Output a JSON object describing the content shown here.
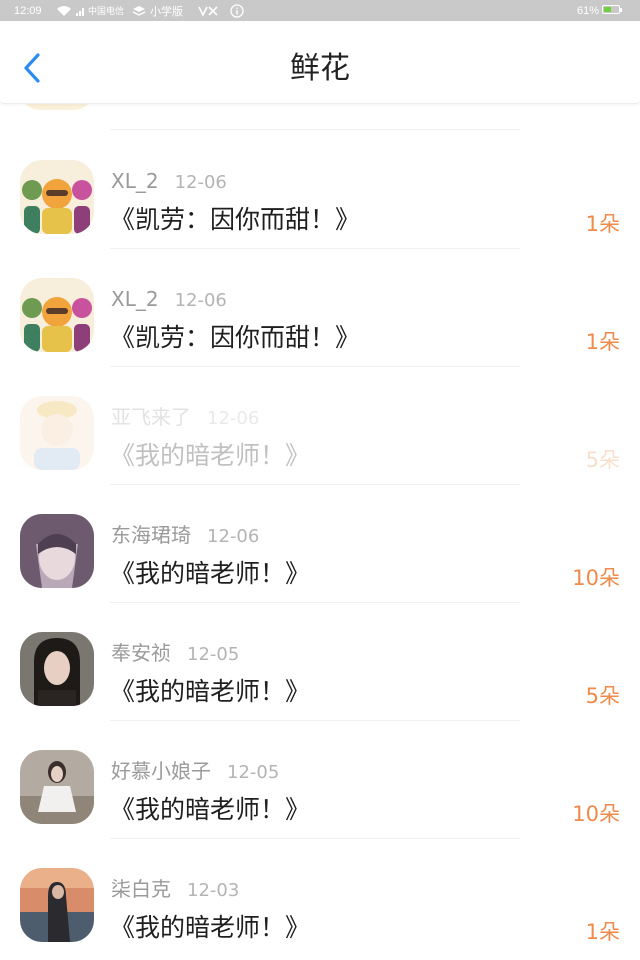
{
  "status_bar": {
    "time": "12:09",
    "carrier": "中国电信",
    "app_label": "小学版",
    "battery": "61%"
  },
  "header": {
    "title": "鲜花",
    "back_icon": "chevron-left-icon",
    "accent_color": "#2d8cf0"
  },
  "flower_list": [
    {
      "name": "XL_2",
      "date": "12-06",
      "title": "《凯劳：因你而甜！》",
      "count": "1朵",
      "avatar": "cartoon-group-avatar"
    },
    {
      "name": "XL_2",
      "date": "12-06",
      "title": "《凯劳：因你而甜！》",
      "count": "1朵",
      "avatar": "cartoon-group-avatar"
    },
    {
      "name": "亚飞来了",
      "date": "12-06",
      "title": "《我的暗老师！》",
      "count": "5朵",
      "avatar": "cartoon-man-avatar"
    },
    {
      "name": "东海珺琦",
      "date": "12-06",
      "title": "《我的暗老师！》",
      "count": "10朵",
      "avatar": "anime-girl-avatar"
    },
    {
      "name": "奉安祯",
      "date": "12-05",
      "title": "《我的暗老师！》",
      "count": "5朵",
      "avatar": "photo-girl-avatar"
    },
    {
      "name": "好慕小娘子",
      "date": "12-05",
      "title": "《我的暗老师！》",
      "count": "10朵",
      "avatar": "photo-girl-sitting-avatar"
    },
    {
      "name": "柒白克",
      "date": "12-03",
      "title": "《我的暗老师！》",
      "count": "1朵",
      "avatar": "sunset-girl-avatar"
    }
  ],
  "colors": {
    "count": "#f08a4b",
    "name": "#9a9a9a",
    "title": "#1f1f1f"
  }
}
